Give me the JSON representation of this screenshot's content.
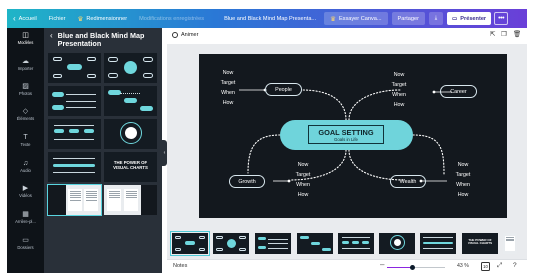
{
  "topbar": {
    "home_label": "Accueil",
    "file_label": "Fichier",
    "resize_label": "Redimensionner",
    "save_status": "Modifications enregistrées",
    "doc_title": "Blue and Black Mind Map Presenta...",
    "try_label": "Essayer Canva...",
    "share_label": "Partager",
    "present_label": "Présenter",
    "more_label": "•••"
  },
  "rail": {
    "items": [
      {
        "label": "Modèles",
        "icon": "template-icon"
      },
      {
        "label": "Importer",
        "icon": "upload-icon"
      },
      {
        "label": "Photos",
        "icon": "photos-icon"
      },
      {
        "label": "Éléments",
        "icon": "elements-icon"
      },
      {
        "label": "Texte",
        "icon": "text-icon"
      },
      {
        "label": "Audio",
        "icon": "audio-icon"
      },
      {
        "label": "Vidéos",
        "icon": "video-icon"
      },
      {
        "label": "Arrière-pl...",
        "icon": "background-icon"
      },
      {
        "label": "Dossiers",
        "icon": "folder-icon"
      }
    ]
  },
  "panel": {
    "title": "Blue and Black Mind Map Presentation",
    "thumb_power_text": "THE POWER OF VISUAL CHARTS"
  },
  "workspace": {
    "animate_label": "Animer"
  },
  "slide": {
    "center_title": "GOAL SETTING",
    "center_subtitle": "Goals in Life",
    "nodes": {
      "people": "People",
      "career": "Career",
      "growth": "Growth",
      "wealth": "Wealth"
    },
    "question_words": [
      "Now",
      "Target",
      "When",
      "How"
    ]
  },
  "filmstrip": {
    "power_text": "THE POWER OF VISUAL CHARTS"
  },
  "footer": {
    "notes_label": "Notes",
    "zoom_value": "43 %",
    "zoom_fraction": 0.43,
    "page_badge": "10"
  },
  "colors": {
    "accent_teal": "#6fd4db",
    "slide_bg": "#13181e",
    "topbar_gradient": [
      "#1fb5c7",
      "#2a78d6",
      "#6a3fd8"
    ],
    "zoom_accent": "#8b27e0"
  }
}
